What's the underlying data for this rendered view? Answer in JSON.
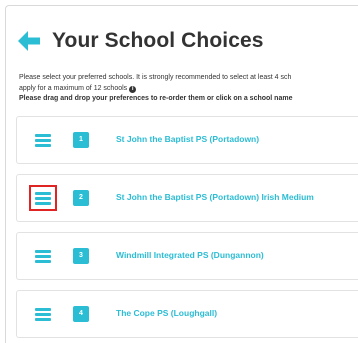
{
  "header": {
    "title": "Your School Choices",
    "back_icon": "arrow-left-icon"
  },
  "intro": {
    "line1": "Please select your preferred schools. It is strongly recommended to select at least 4 sch",
    "line2": "apply for a maximum of 12 schools",
    "info_icon_glyph": "i",
    "line3": "Please drag and drop your preferences to re-order them or click on a school name"
  },
  "colors": {
    "accent": "#2bbdd4",
    "highlight": "#e02424",
    "text": "#333333"
  },
  "choices": [
    {
      "rank": "1",
      "name": "St John the Baptist PS (Portadown)"
    },
    {
      "rank": "2",
      "name": "St John the Baptist PS (Portadown) Irish Medium"
    },
    {
      "rank": "3",
      "name": "Windmill Integrated PS (Dungannon)"
    },
    {
      "rank": "4",
      "name": "The Cope PS (Loughgall)"
    }
  ]
}
